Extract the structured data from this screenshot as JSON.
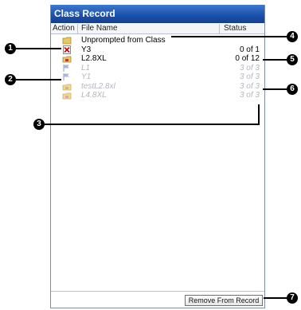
{
  "window": {
    "title": "Class Record"
  },
  "columns": {
    "action": "Action",
    "file_name": "File Name",
    "status": "Status"
  },
  "rows": [
    {
      "icon": "folder-icon",
      "name": "Unprompted from Class",
      "status": "",
      "dim": false
    },
    {
      "icon": "remove-x-icon",
      "name": "Y3",
      "status": "0 of 1",
      "dim": false
    },
    {
      "icon": "record-icon",
      "name": "L2.8XL",
      "status": "0 of 12",
      "dim": false
    },
    {
      "icon": "flag-icon",
      "name": "L1",
      "status": "3 of 3",
      "dim": true
    },
    {
      "icon": "flag-icon",
      "name": "Y1",
      "status": "3 of 3",
      "dim": true
    },
    {
      "icon": "record-icon",
      "name": "testL2.8xl",
      "status": "3 of 3",
      "dim": true
    },
    {
      "icon": "record-icon",
      "name": "L4.8XL",
      "status": "3 of 3",
      "dim": true
    }
  ],
  "footer": {
    "remove_button": "Remove From Record"
  },
  "callouts": [
    "1",
    "2",
    "3",
    "4",
    "5",
    "6",
    "7"
  ]
}
